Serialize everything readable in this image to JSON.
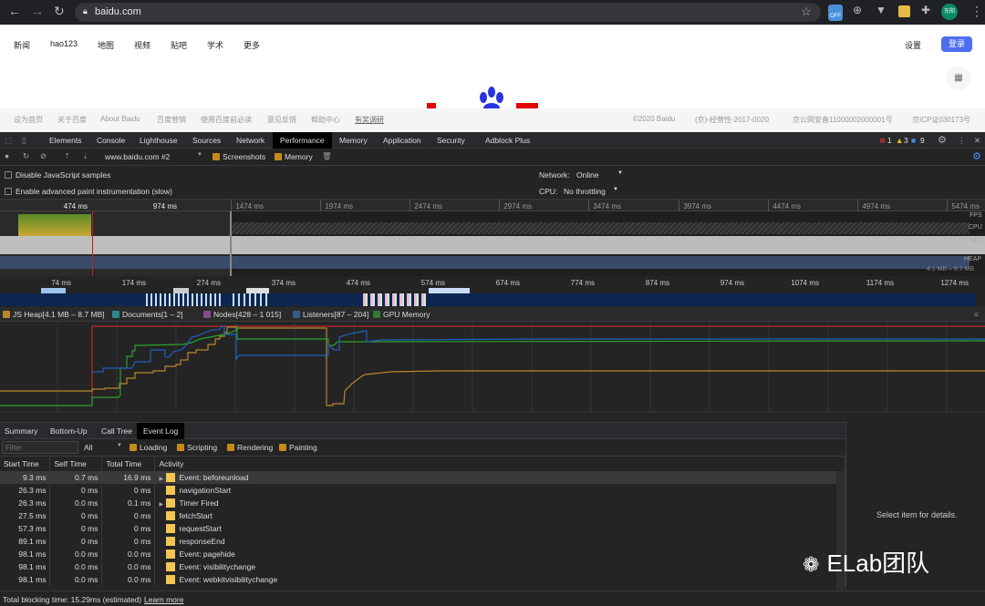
{
  "browser": {
    "url": "baidu.com",
    "avatar": "东阳",
    "ext_off": "OFF"
  },
  "baidu": {
    "nav": [
      "新闻",
      "hao123",
      "地图",
      "视频",
      "贴吧",
      "学术",
      "更多"
    ],
    "settings": "设置",
    "login": "登录",
    "footer_left": [
      "设为首页",
      "关于百度",
      "About Baidu",
      "百度营销",
      "使用百度前必读",
      "意见反馈",
      "帮助中心",
      "有奖调研"
    ],
    "footer_right": [
      "©2020 Baidu",
      "(京)-经营性-2017-0020",
      "京公网安备11000002000001号",
      "京ICP证030173号"
    ]
  },
  "devtools": {
    "tabs": [
      "Elements",
      "Console",
      "Lighthouse",
      "Sources",
      "Network",
      "Performance",
      "Memory",
      "Application",
      "Security",
      "Adblock Plus"
    ],
    "active_tab": "Performance",
    "badges": {
      "errors": "1",
      "warnings": "3",
      "info": "9"
    },
    "toolbar": {
      "profile": "www.baidu.com #2",
      "screenshots": "Screenshots",
      "memory": "Memory"
    },
    "settings": {
      "disable_js": "Disable JavaScript samples",
      "paint": "Enable advanced paint instrumentation (slow)",
      "network_label": "Network:",
      "network_value": "Online",
      "cpu_label": "CPU:",
      "cpu_value": "No throttling"
    },
    "overview": {
      "ticks": [
        "474 ms",
        "974 ms",
        "1474 ms",
        "1974 ms",
        "2474 ms",
        "2974 ms",
        "3474 ms",
        "3974 ms",
        "4474 ms",
        "4974 ms",
        "5474 ms"
      ],
      "labels": [
        "FPS",
        "CPU",
        "NET",
        "HEAP"
      ],
      "heap_range": "4.1 MB – 8.7 MB"
    },
    "timeline": {
      "ticks": [
        "74 ms",
        "174 ms",
        "274 ms",
        "374 ms",
        "474 ms",
        "574 ms",
        "674 ms",
        "774 ms",
        "874 ms",
        "974 ms",
        "1074 ms",
        "1174 ms",
        "1274 ms"
      ]
    },
    "memory_legend": [
      {
        "label": "JS Heap[4.1 MB – 8.7 MB]",
        "color": "#b8862c"
      },
      {
        "label": "Documents[1 – 2]",
        "color": "#2a8a8a"
      },
      {
        "label": "Nodes[428 – 1 015]",
        "color": "#8a4a8a"
      },
      {
        "label": "Listeners[87 – 204]",
        "color": "#3a5a8a"
      },
      {
        "label": "GPU Memory",
        "color": "#2e7d32"
      }
    ],
    "bottom_tabs": [
      "Summary",
      "Bottom-Up",
      "Call Tree",
      "Event Log"
    ],
    "active_bottom_tab": "Event Log",
    "filter": {
      "placeholder": "Filter",
      "all": "All",
      "checks": [
        "Loading",
        "Scripting",
        "Rendering",
        "Painting"
      ]
    },
    "columns": [
      "Start Time",
      "Self Time",
      "Total Time",
      "Activity"
    ],
    "rows": [
      {
        "start": "9.3 ms",
        "self": "0.7 ms",
        "total": "16.9 ms",
        "activity": "Event: beforeunload",
        "expand": true
      },
      {
        "start": "26.3 ms",
        "self": "0 ms",
        "total": "0 ms",
        "activity": "navigationStart",
        "expand": false
      },
      {
        "start": "26.3 ms",
        "self": "0.0 ms",
        "total": "0.1 ms",
        "activity": "Timer Fired",
        "expand": true
      },
      {
        "start": "27.5 ms",
        "self": "0 ms",
        "total": "0 ms",
        "activity": "fetchStart",
        "expand": false
      },
      {
        "start": "57.3 ms",
        "self": "0 ms",
        "total": "0 ms",
        "activity": "requestStart",
        "expand": false
      },
      {
        "start": "89.1 ms",
        "self": "0 ms",
        "total": "0 ms",
        "activity": "responseEnd",
        "expand": false
      },
      {
        "start": "98.1 ms",
        "self": "0.0 ms",
        "total": "0.0 ms",
        "activity": "Event: pagehide",
        "expand": false
      },
      {
        "start": "98.1 ms",
        "self": "0.0 ms",
        "total": "0.0 ms",
        "activity": "Event: visibilitychange",
        "expand": false
      },
      {
        "start": "98.1 ms",
        "self": "0.0 ms",
        "total": "0.0 ms",
        "activity": "Event: webkitvisibilitychange",
        "expand": false
      }
    ],
    "details": "Select item for details.",
    "status": "Total blocking time: 15.29ms (estimated)",
    "learn_more": "Learn more"
  },
  "watermark": "ELab团队"
}
